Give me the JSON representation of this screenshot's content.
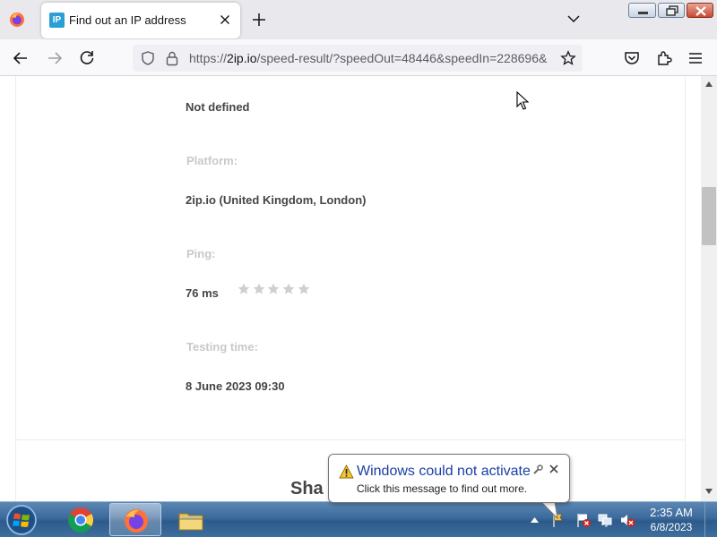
{
  "browser": {
    "tab": {
      "favicon_text": "IP",
      "title": "Find out an IP address"
    },
    "url": {
      "prefix": "https://",
      "host": "2ip.io",
      "path": "/speed-result/?speedOut=48446&speedIn=228696&"
    }
  },
  "page": {
    "previous_value": "Not defined",
    "platform": {
      "label": "Platform:",
      "value": "2ip.io (United Kingdom, London)"
    },
    "ping": {
      "label": "Ping:",
      "value": "76 ms",
      "rating": {
        "stars_total": 5,
        "stars_filled": 0
      }
    },
    "testing_time": {
      "label": "Testing time:",
      "value": "8 June 2023 09:30"
    },
    "share_heading": "Sha"
  },
  "notification": {
    "title": "Windows could not activate",
    "message": "Click this message to find out more."
  },
  "taskbar": {
    "clock": {
      "time": "2:35 AM",
      "date": "6/8/2023"
    }
  },
  "colors": {
    "accent_link": "#1a3fa6",
    "label_grey": "#c9c9c9",
    "value_dark": "#454545",
    "star_grey": "#cfcfcf"
  }
}
